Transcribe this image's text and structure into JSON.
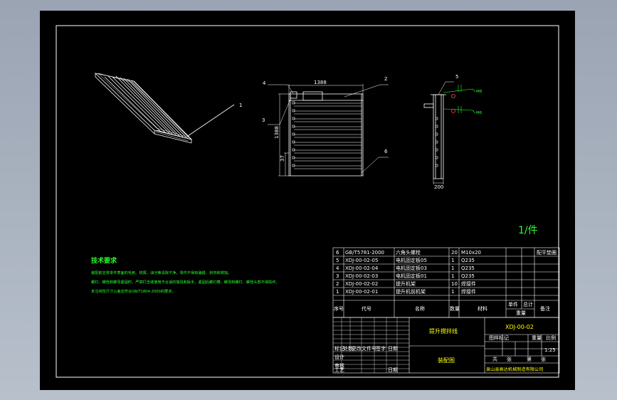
{
  "drawing": {
    "dims": {
      "width": "1388",
      "height": "1388",
      "pitch": "37",
      "side_width": "200"
    },
    "balloons": [
      "1",
      "2",
      "3",
      "4",
      "5",
      "6"
    ],
    "side_labels": [
      "M8",
      "M6"
    ],
    "quantity": "1/件",
    "tech": {
      "title": "技术要求",
      "lines": [
        "装配前应将零件表面的毛刺、铁屑、油污等清除干净，零件不得有磕碰、划伤和锈蚀。",
        "螺钉、螺栓和螺母紧固时，严禁打击或使用不合适的旋具和扳手，紧固后螺钉槽、螺母和螺钉、螺栓头部不得损坏。",
        "未注线性尺寸公差应符合GB/T1804-2000的要求。"
      ]
    }
  },
  "bom": {
    "rows": [
      {
        "no": "6",
        "code": "GB/T5781-2000",
        "name": "六角头螺栓",
        "qty": "20",
        "material": "M10x20",
        "note": "配平垫圈"
      },
      {
        "no": "5",
        "code": "XDJ-00-02-05",
        "name": "电机固定板05",
        "qty": "1",
        "material": "Q235",
        "note": ""
      },
      {
        "no": "4",
        "code": "XDJ-00-02-04",
        "name": "电机固定板03",
        "qty": "1",
        "material": "Q235",
        "note": ""
      },
      {
        "no": "3",
        "code": "XDJ-00-02-03",
        "name": "电机固定板01",
        "qty": "1",
        "material": "Q235",
        "note": ""
      },
      {
        "no": "2",
        "code": "XDJ-00-02-02",
        "name": "提升机架",
        "qty": "10",
        "material": "焊接件",
        "note": ""
      },
      {
        "no": "1",
        "code": "XDJ-00-02-01",
        "name": "提升机前机架",
        "qty": "1",
        "material": "焊接件",
        "note": ""
      }
    ],
    "headers": {
      "no": "序号",
      "code": "代号",
      "name": "名称",
      "qty": "数量",
      "material": "材料",
      "unit": "单件",
      "total": "总计",
      "weight": "重量",
      "note": "备注"
    }
  },
  "title_block": {
    "product": "提升搅拌线",
    "drawing_no": "XDJ-00-02",
    "view": "装配图",
    "company": "泉山县高达机械制造有限公司",
    "stage_labels": [
      "图样标记",
      "重量",
      "比例"
    ],
    "scale": "1:25",
    "sheet_labels": [
      "共",
      "张",
      "第",
      "张"
    ],
    "signoff_labels": [
      "设计",
      "审核",
      "工艺",
      "标记",
      "处数",
      "更改文件号",
      "签字",
      "日期",
      "日期"
    ]
  }
}
